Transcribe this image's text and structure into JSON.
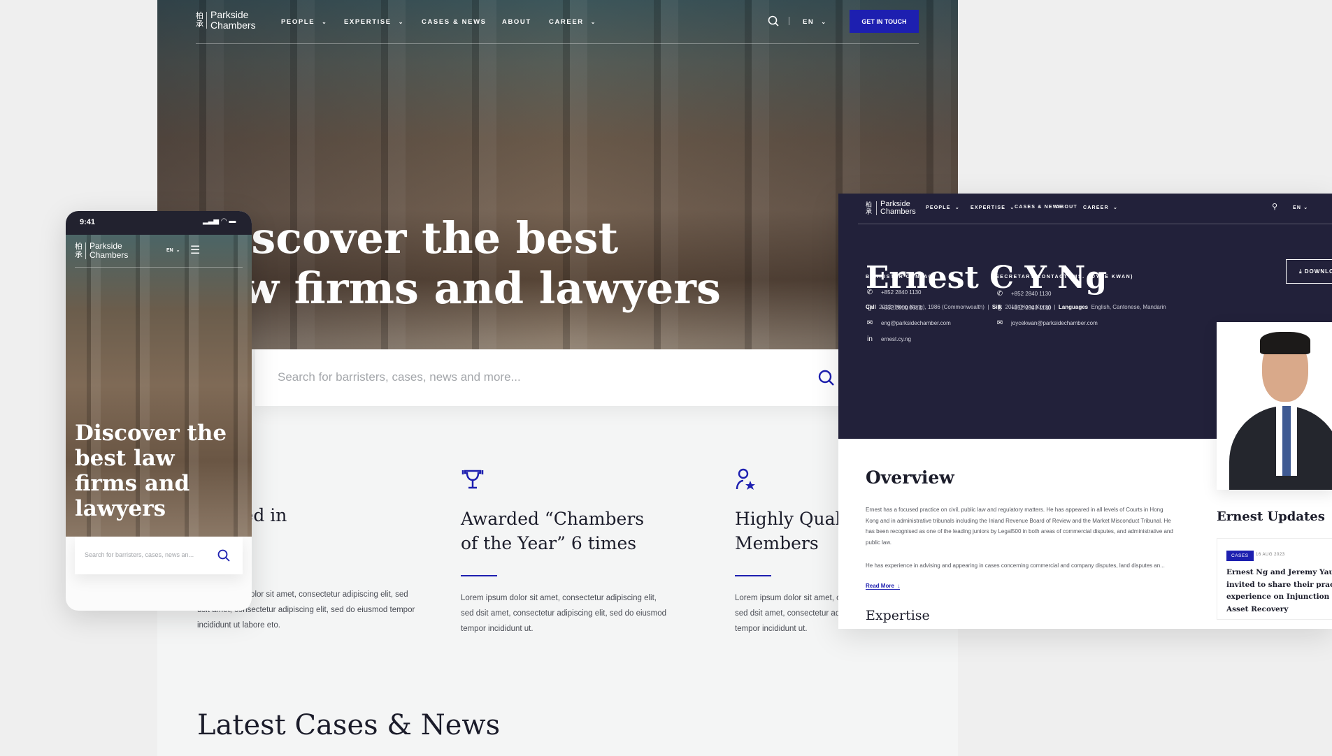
{
  "brand": {
    "mark": "柏承",
    "name_line1": "Parkside",
    "name_line2": "Chambers"
  },
  "desktop": {
    "nav": {
      "items": [
        {
          "label": "PEOPLE",
          "dropdown": true
        },
        {
          "label": "EXPERTISE",
          "dropdown": true
        },
        {
          "label": "CASES & NEWS",
          "dropdown": false
        },
        {
          "label": "ABOUT",
          "dropdown": false
        },
        {
          "label": "CAREER",
          "dropdown": true
        }
      ],
      "lang": "EN",
      "cta": "GET IN TOUCH"
    },
    "hero": {
      "line1": "Discover the best",
      "line2": "law firms and lawyers"
    },
    "search": {
      "placeholder": "Search for barristers, cases, news and more..."
    },
    "features": [
      {
        "icon": "ranking-icon",
        "title_line1": "Ranked in",
        "title_line2": "",
        "text": "Lorem ipsum dolor sit amet, consectetur adipiscing elit, sed dsit amet, consectetur adipiscing elit, sed do eiusmod tempor incididunt ut labore eto."
      },
      {
        "icon": "trophy-icon",
        "title_line1": "Awarded “Chambers",
        "title_line2": "of the Year” 6 times",
        "text": "Lorem ipsum dolor sit amet, consectetur adipiscing elit, sed dsit amet, consectetur adipiscing elit, sed do eiusmod tempor incididunt ut."
      },
      {
        "icon": "user-star-icon",
        "title_line1": "Highly Qualified",
        "title_line2": "Members",
        "text": "Lorem ipsum dolor sit amet, consectetur adipiscing elit, sed dsit amet, consectetur adipiscing elit, sed do eiusmod tempor incididunt ut."
      }
    ],
    "latest_heading": "Latest Cases & News"
  },
  "mobile": {
    "time": "9:41",
    "lang": "EN",
    "hero": "Discover the best law firms and lawyers",
    "search_placeholder": "Search for barristers, cases, news an..."
  },
  "profile": {
    "name": "Ernest C Y Ng",
    "download_label": "DOWNLOAD",
    "meta": {
      "call_label": "Call",
      "call": "2013 (Hong Kong), 1986 (Commonwealth)",
      "silk_label": "Silk",
      "silk": "2015 (Hong Kong)",
      "lang_label": "Languages",
      "langs": "English, Cantonese, Mandarin"
    },
    "barrister_contact": {
      "heading": "BARRISTER CONTACT",
      "phone": "+852 2840 1130",
      "mobile": "+852 2810 0612",
      "email": "eng@parksidechamber.com",
      "linkedin": "ernest.cy.ng"
    },
    "secretary_contact": {
      "heading": "SECRETARY CONTACT (MS. JOYCE KWAN)",
      "phone": "+852 2840 1130",
      "mobile": "+852 2840 1130",
      "email": "joycekwan@parksidechamber.com"
    },
    "overview_heading": "Overview",
    "overview_p1": "Ernest has a focused practice on civil, public law and regulatory matters. He has appeared in all levels of Courts in Hong Kong and in administrative tribunals including the Inland Revenue Board of Review and the Market Misconduct Tribunal. He has been recognised as one of the leading juniors by Legal500 in both areas of commercial disputes, and administrative and public law.",
    "overview_p2": "He has experience in advising and appearing in cases concerning commercial and company disputes, land disputes an...",
    "read_more": "Read More",
    "expertise_heading": "Expertise",
    "updates_heading": "Ernest Updates",
    "update": {
      "tag": "CASES",
      "date": "16 AUG 2023",
      "title": "Ernest Ng and Jeremy Yau were invited to share their practical experience on Injunction and Asset Recovery"
    }
  },
  "colors": {
    "accent": "#1d1fb0",
    "dark": "#22213a",
    "background": "#efefef"
  }
}
